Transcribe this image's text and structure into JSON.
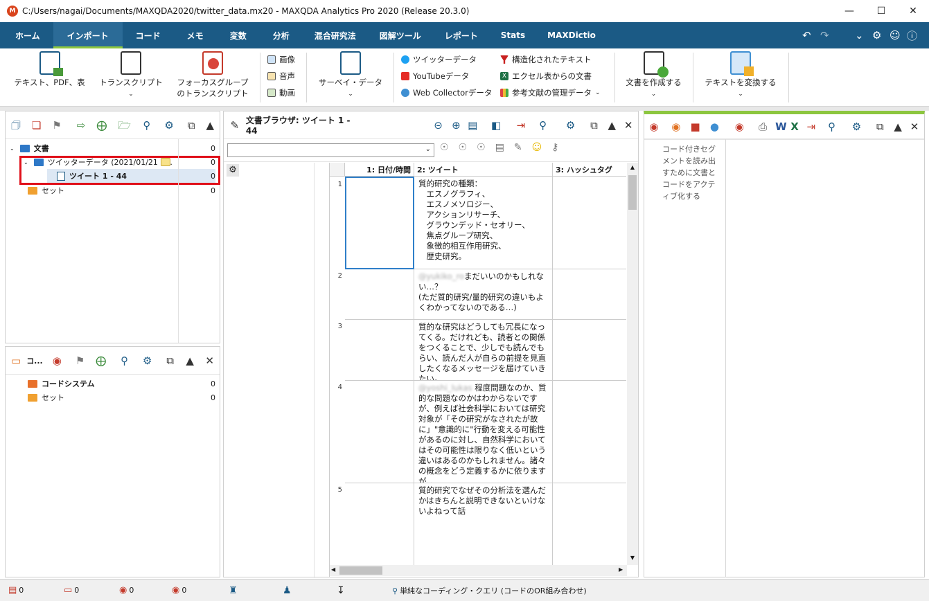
{
  "window": {
    "title": "C:/Users/nagai/Documents/MAXQDA2020/twitter_data.mx20 - MAXQDA Analytics Pro 2020 (Release 20.3.0)",
    "app_icon_text": "M"
  },
  "menu": {
    "tabs": [
      "ホーム",
      "インポート",
      "コード",
      "メモ",
      "変数",
      "分析",
      "混合研究法",
      "図解ツール",
      "レポート",
      "Stats",
      "MAXDictio"
    ],
    "active_index": 1
  },
  "ribbon": {
    "text_pdf": "テキスト、PDF、表",
    "transcript": "トランスクリプト",
    "focus_group_1": "フォーカスグループ",
    "focus_group_2": "のトランスクリプト",
    "image": "画像",
    "audio": "音声",
    "video": "動画",
    "survey": "サーベイ・データ",
    "twitter": "ツイッターデータ",
    "youtube": "YouTubeデータ",
    "webcollector": "Web Collectorデータ",
    "structured": "構造化されたテキスト",
    "excel": "エクセル表からの文書",
    "bibliography": "参考文献の管理データ",
    "create_doc": "文書を作成する",
    "convert_text": "テキストを変換する"
  },
  "doc_system": {
    "root": {
      "label": "文書",
      "count": "0"
    },
    "group": {
      "label": "ツイッターデータ (2021/01/21 1...",
      "count": "0"
    },
    "doc": {
      "label": "ツイート 1 - 44",
      "count": "0"
    },
    "sets": {
      "label": "セット",
      "count": "0"
    }
  },
  "code_system": {
    "panel_label": "コ...",
    "root": {
      "label": "コードシステム",
      "count": "0"
    },
    "sets": {
      "label": "セット",
      "count": "0"
    }
  },
  "browser": {
    "title": "文書ブラウザ: ツイート 1 - 44",
    "columns": [
      "1: 日付/時間",
      "2: ツイート",
      "3: ハッシュタグ"
    ],
    "rows": [
      {
        "num": "1",
        "date": "",
        "tweet": "質的研究の種類：\n　エスノグラフィ、\n　エスノメソロジー、\n　アクションリサーチ、\n　グラウンデッド・セオリー、\n　焦点グループ研究、\n　象徴的相互作用研究、\n　歴史研究。",
        "tag": ""
      },
      {
        "num": "2",
        "date": "",
        "tweet": "まだいいのかもしれない…？\n(ただ質的研究/量的研究の違いもよくわかってないのである…)",
        "tag": "",
        "mention": "@yukiko_ro"
      },
      {
        "num": "3",
        "date": "",
        "tweet": "質的な研究はどうしても冗長になってくる。だけれども、読者との関係をつくることで、少しでも読んでもらい、読んだ人が自らの前提を見直したくなるメッセージを届けていきたい。",
        "tag": ""
      },
      {
        "num": "4",
        "date": "",
        "tweet": " 程度問題なのか、質的な問題なのかはわからないですが、例えば社会科学においては研究対象が「その研究がなされたが故に」\"意識的に\"行動を変える可能性があるのに対し、自然科学においてはその可能性は限りなく低いという違いはあるのかもしれません。諸々の概念をどう定義するかに依りますが、、",
        "tag": "",
        "mention": "@yoshi_lukas"
      },
      {
        "num": "5",
        "date": "",
        "tweet": "質的研究でなぜその分析法を選んだかはきちんと説明できないといけないよねって話",
        "tag": ""
      }
    ]
  },
  "retrieved": {
    "hint": "コード付きセグメントを読み出すために文書とコードをアクティブ化する"
  },
  "status": {
    "docs": "0",
    "memos": "0",
    "codes": "0",
    "segments": "0",
    "query": "単純なコーディング・クエリ (コードのOR組み合わせ)"
  },
  "colors": {
    "menu_bg": "#1b5a85",
    "accent_green": "#8cc63f",
    "highlight_red": "#e0101a"
  }
}
